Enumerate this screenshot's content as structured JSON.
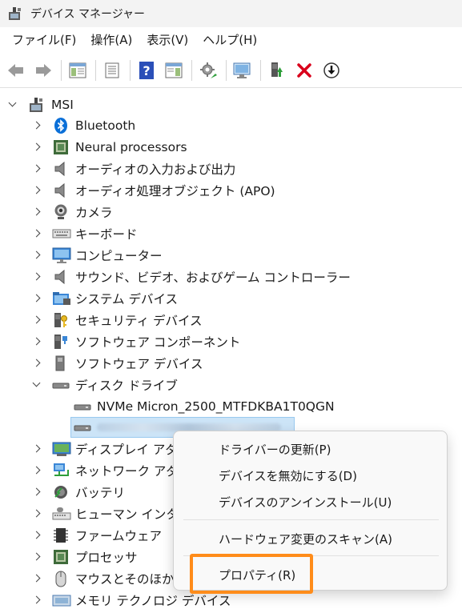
{
  "window": {
    "title": "デバイス マネージャー"
  },
  "menubar": {
    "items": [
      "ファイル(F)",
      "操作(A)",
      "表示(V)",
      "ヘルプ(H)"
    ]
  },
  "tree": {
    "root": "MSI",
    "categories": [
      {
        "label": "Bluetooth",
        "icon": "bluetooth-icon"
      },
      {
        "label": "Neural processors",
        "icon": "processor-chip-icon"
      },
      {
        "label": "オーディオの入力および出力",
        "icon": "speaker-icon"
      },
      {
        "label": "オーディオ処理オブジェクト (APO)",
        "icon": "speaker-icon"
      },
      {
        "label": "カメラ",
        "icon": "camera-icon"
      },
      {
        "label": "キーボード",
        "icon": "keyboard-icon"
      },
      {
        "label": "コンピューター",
        "icon": "monitor-icon"
      },
      {
        "label": "サウンド、ビデオ、およびゲーム コントローラー",
        "icon": "speaker-icon"
      },
      {
        "label": "システム デバイス",
        "icon": "system-folder-icon"
      },
      {
        "label": "セキュリティ デバイス",
        "icon": "security-key-icon"
      },
      {
        "label": "ソフトウェア コンポーネント",
        "icon": "software-component-icon"
      },
      {
        "label": "ソフトウェア デバイス",
        "icon": "software-device-icon"
      },
      {
        "label": "ディスク ドライブ",
        "icon": "disk-drive-icon"
      }
    ],
    "disk_children": [
      {
        "label": "NVMe Micron_2500_MTFDKBA1T0QGN",
        "icon": "disk-drive-icon"
      }
    ],
    "after_categories": [
      {
        "label": "ディスプレイ アダプ",
        "icon": "display-adapter-icon"
      },
      {
        "label": "ネットワーク アダプ",
        "icon": "network-icon"
      },
      {
        "label": "バッテリ",
        "icon": "battery-icon"
      },
      {
        "label": "ヒューマン インターフ",
        "icon": "hid-icon"
      },
      {
        "label": "ファームウェア",
        "icon": "firmware-chip-icon"
      },
      {
        "label": "プロセッサ",
        "icon": "processor-chip-icon"
      },
      {
        "label": "マウスとそのほかの",
        "icon": "mouse-icon"
      },
      {
        "label": "メモリ テクノロジ デバイス",
        "icon": "memory-icon"
      }
    ]
  },
  "context_menu": {
    "items": [
      "ドライバーの更新(P)",
      "デバイスを無効にする(D)",
      "デバイスのアンインストール(U)",
      "ハードウェア変更のスキャン(A)",
      "プロパティ(R)"
    ]
  },
  "colors": {
    "highlight_outline": "#ff8c1a",
    "selection": "#cce4f7",
    "uninstall_red": "#d9001b"
  }
}
